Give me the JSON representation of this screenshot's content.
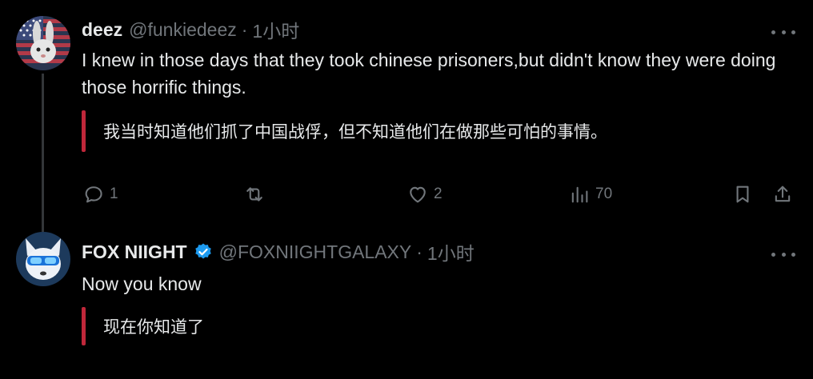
{
  "tweets": [
    {
      "display_name": "deez",
      "handle": "@funkiedeez",
      "separator": "·",
      "time": "1小时",
      "text": "I knew in those days that they took chinese prisoners,but didn't know they were doing those horrific things.",
      "translation": "我当时知道他们抓了中国战俘，但不知道他们在做那些可怕的事情。",
      "avatar_icon": "flag-rabbit-avatar",
      "verified": false,
      "actions": {
        "reply_count": "1",
        "retweet_count": "",
        "like_count": "2",
        "views_count": "70"
      }
    },
    {
      "display_name": "FOX NIIGHT",
      "handle": "@FOXNIIGHTGALAXY",
      "separator": "·",
      "time": "1小时",
      "text": "Now you know",
      "translation": "现在你知道了",
      "avatar_icon": "fox-sunglasses-avatar",
      "verified": true
    }
  ],
  "colors": {
    "background": "#000000",
    "text": "#e7e9ea",
    "muted": "#71767b",
    "verified_blue": "#1d9bf0",
    "translation_bar": "#c0273a",
    "thread_line": "#333639"
  }
}
